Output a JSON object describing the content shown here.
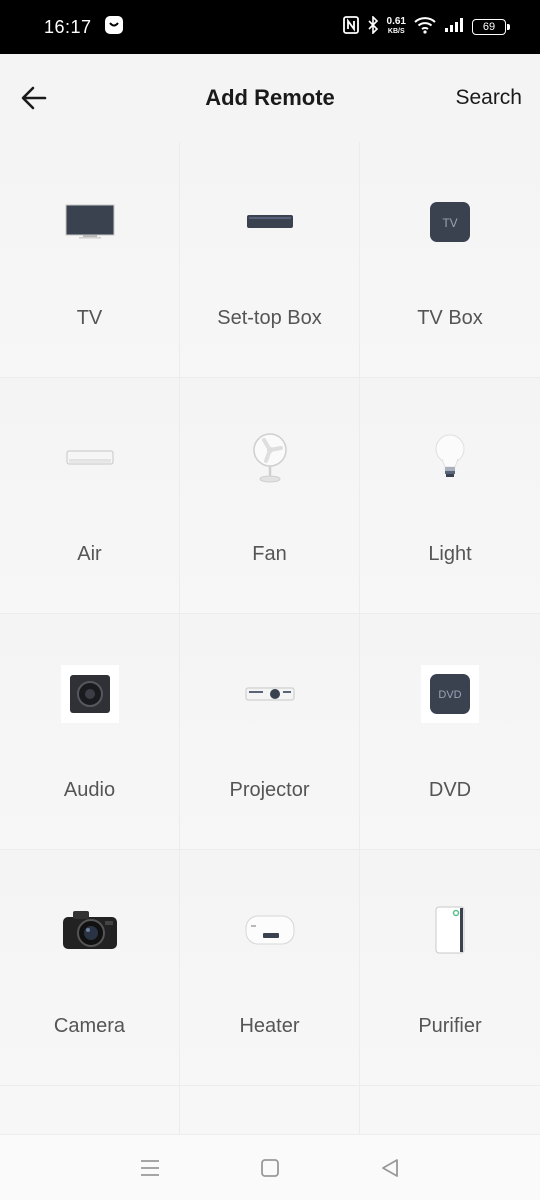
{
  "status_bar": {
    "time": "16:17",
    "speed_value": "0.61",
    "speed_unit": "KB/S",
    "battery": "69"
  },
  "header": {
    "title": "Add Remote",
    "search_label": "Search"
  },
  "devices": [
    {
      "label": "TV",
      "icon": "tv-icon"
    },
    {
      "label": "Set-top Box",
      "icon": "set-top-box-icon"
    },
    {
      "label": "TV Box",
      "icon": "tv-box-icon",
      "icon_text": "TV"
    },
    {
      "label": "Air",
      "icon": "air-conditioner-icon"
    },
    {
      "label": "Fan",
      "icon": "fan-icon"
    },
    {
      "label": "Light",
      "icon": "light-bulb-icon"
    },
    {
      "label": "Audio",
      "icon": "speaker-icon"
    },
    {
      "label": "Projector",
      "icon": "projector-icon"
    },
    {
      "label": "DVD",
      "icon": "dvd-icon",
      "icon_text": "DVD"
    },
    {
      "label": "Camera",
      "icon": "camera-icon"
    },
    {
      "label": "Heater",
      "icon": "water-heater-icon"
    },
    {
      "label": "Purifier",
      "icon": "air-purifier-icon"
    }
  ],
  "colors": {
    "accent_dark": "#3a4250",
    "background": "#f4f4f4",
    "text": "#555555"
  }
}
